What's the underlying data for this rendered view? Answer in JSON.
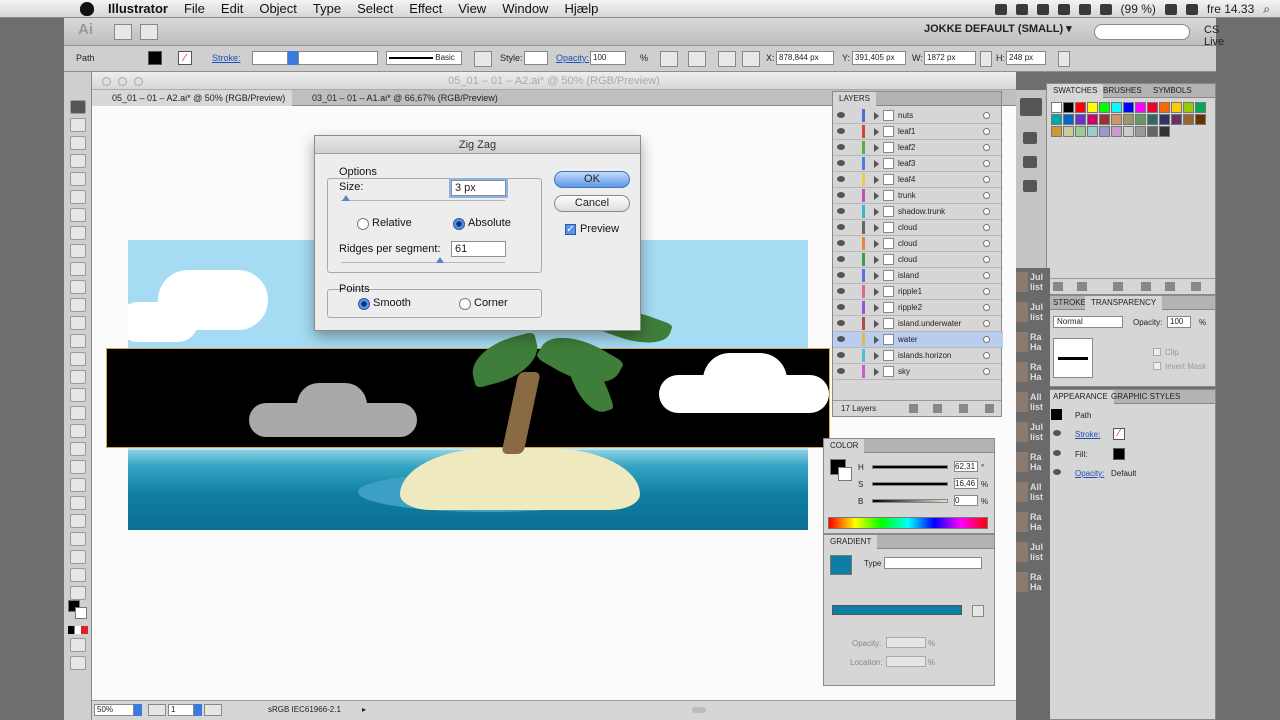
{
  "menubar": {
    "app": "Illustrator",
    "items": [
      "File",
      "Edit",
      "Object",
      "Type",
      "Select",
      "Effect",
      "View",
      "Window",
      "Hjælp"
    ],
    "battery": "(99 %)",
    "clock": "fre 14.33"
  },
  "appbar": {
    "logo": "Ai",
    "workspace": "JOKKE DEFAULT (SMALL) ▾",
    "cslive": "CS Live ▾"
  },
  "control": {
    "object_type": "Path",
    "stroke_label": "Stroke:",
    "brush": "Basic",
    "style_label": "Style:",
    "opacity_label": "Opacity:",
    "opacity_value": "100",
    "opacity_unit": "%",
    "x_label": "X:",
    "x_value": "878,844 px",
    "y_label": "Y:",
    "y_value": "391,405 px",
    "w_label": "W:",
    "w_value": "1872 px",
    "h_label": "H:",
    "h_value": "248 px"
  },
  "document": {
    "window_title": "05_01 – 01 – A2.ai* @ 50% (RGB/Preview)",
    "tabs": [
      {
        "label": "05_01 – 01 – A2.ai* @ 50% (RGB/Preview)",
        "active": true
      },
      {
        "label": "03_01 – 01 – A1.ai* @ 66,67% (RGB/Preview)",
        "active": false
      }
    ],
    "zoom": "50%",
    "page": "1",
    "profile": "sRGB IEC61966-2.1"
  },
  "dialog": {
    "title": "Zig Zag",
    "options_label": "Options",
    "size_label": "Size:",
    "size_value": "3 px",
    "relative_label": "Relative",
    "absolute_label": "Absolute",
    "size_mode": "Absolute",
    "ridges_label": "Ridges per segment:",
    "ridges_value": "61",
    "points_label": "Points",
    "smooth_label": "Smooth",
    "corner_label": "Corner",
    "points_mode": "Smooth",
    "ok_label": "OK",
    "cancel_label": "Cancel",
    "preview_label": "Preview",
    "preview_checked": true
  },
  "layers": {
    "tab": "LAYERS",
    "items": [
      {
        "name": "nuts",
        "color": "#4f6fd3"
      },
      {
        "name": "leaf1",
        "color": "#d0433f"
      },
      {
        "name": "leaf2",
        "color": "#55b04a"
      },
      {
        "name": "leaf3",
        "color": "#4a7fe0"
      },
      {
        "name": "leaf4",
        "color": "#e2d24a"
      },
      {
        "name": "trunk",
        "color": "#c34ec0"
      },
      {
        "name": "shadow.trunk",
        "color": "#38b8c8"
      },
      {
        "name": "cloud",
        "color": "#666666"
      },
      {
        "name": "cloud",
        "color": "#e08a3a"
      },
      {
        "name": "cloud",
        "color": "#3f9e45"
      },
      {
        "name": "island",
        "color": "#5d6fe0"
      },
      {
        "name": "ripple1",
        "color": "#e06a90"
      },
      {
        "name": "ripple2",
        "color": "#8f5ad6"
      },
      {
        "name": "island.underwater",
        "color": "#b24949"
      },
      {
        "name": "water",
        "color": "#e0b84a",
        "selected": true
      },
      {
        "name": "islands.horizon",
        "color": "#57b8d8"
      },
      {
        "name": "sky",
        "color": "#c85fc4"
      }
    ],
    "count": "17 Layers"
  },
  "swatches": {
    "tabs": [
      "SWATCHES",
      "BRUSHES",
      "SYMBOLS"
    ]
  },
  "transparency": {
    "tabs": [
      "STROKE",
      "TRANSPARENCY"
    ],
    "mode": "Normal",
    "opacity_label": "Opacity:",
    "opacity_value": "100",
    "opacity_unit": "%",
    "clip": "Clip",
    "invert": "Invert Mask"
  },
  "appearance": {
    "tabs": [
      "APPEARANCE",
      "GRAPHIC STYLES"
    ],
    "object": "Path",
    "stroke": "Stroke:",
    "fill": "Fill:",
    "opacity": "Opacity:",
    "opacity_value": "Default"
  },
  "color": {
    "tab": "COLOR",
    "h_label": "H",
    "h_value": "62,31",
    "h_unit": "°",
    "s_label": "S",
    "s_value": "16,46",
    "s_unit": "%",
    "b_label": "B",
    "b_value": "0",
    "b_unit": "%"
  },
  "gradient": {
    "tab": "GRADIENT",
    "type_label": "Type",
    "opacity_label": "Opacity:",
    "location_label": "Location:",
    "unit": "%"
  },
  "strip": [
    {
      "label": "Jul list"
    },
    {
      "label": "Jul list"
    },
    {
      "label": "Ra Ha"
    },
    {
      "label": "Ra Ha"
    },
    {
      "label": "All list"
    },
    {
      "label": "Jul list"
    },
    {
      "label": "Ra Ha"
    },
    {
      "label": "All list"
    },
    {
      "label": "Ra Ha"
    },
    {
      "label": "Jul list"
    },
    {
      "label": "Ra Ha"
    }
  ]
}
